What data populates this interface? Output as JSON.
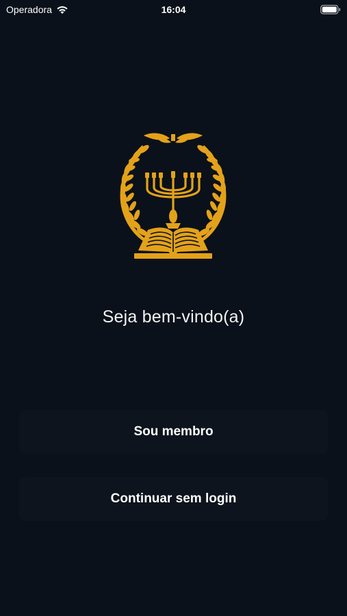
{
  "status_bar": {
    "carrier": "Operadora",
    "time": "16:04",
    "wifi_icon": "wifi-icon",
    "battery_icon": "battery-icon"
  },
  "logo": {
    "icon": "menorah-laurel-book-emblem",
    "color": "#e3a21a"
  },
  "welcome": {
    "text": "Seja bem-vindo(a)"
  },
  "buttons": {
    "member_label": "Sou membro",
    "guest_label": "Continuar sem login"
  },
  "colors": {
    "background": "#0b111a",
    "button_background": "#0d141d",
    "accent": "#e3a21a",
    "text": "#ffffff"
  }
}
